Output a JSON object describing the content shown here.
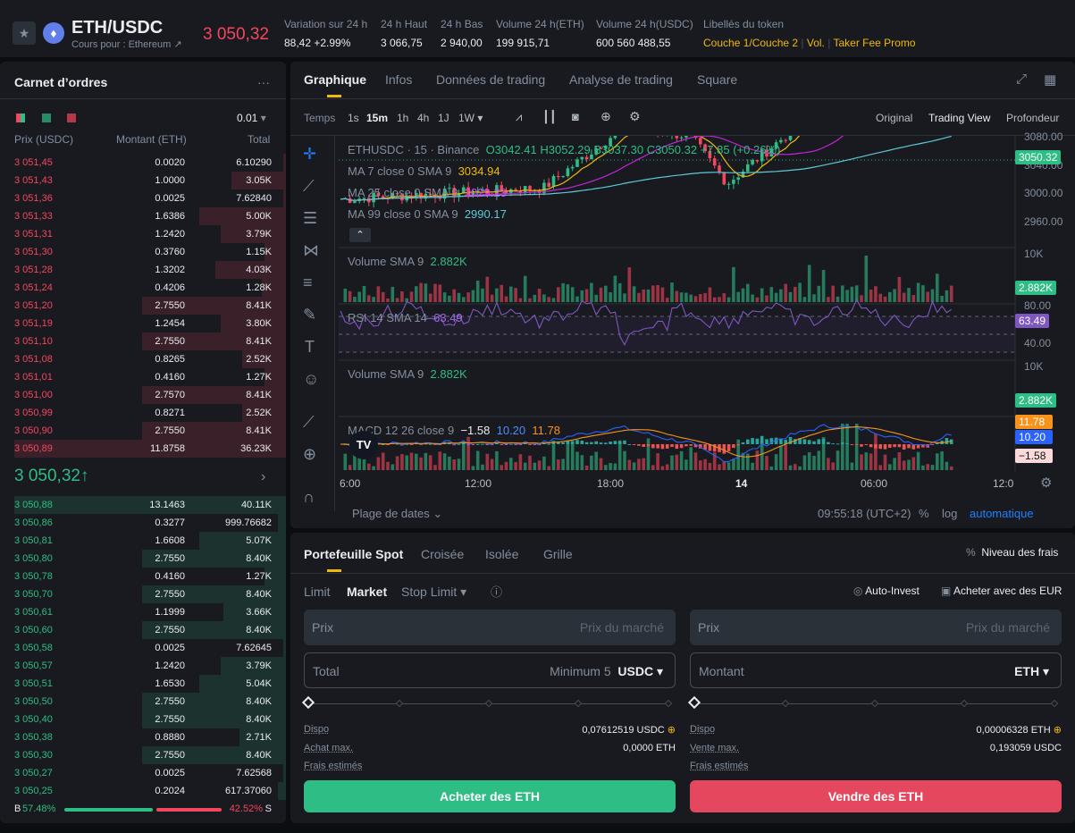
{
  "header": {
    "pair": "ETH/USDC",
    "subtitle": "Cours pour : Ethereum ↗",
    "price": "3 050,32",
    "stats": [
      {
        "label": "Variation sur 24 h",
        "value": "88,42 +2.99%"
      },
      {
        "label": "24 h Haut",
        "value": "3 066,75"
      },
      {
        "label": "24 h Bas",
        "value": "2 940,00"
      },
      {
        "label": "Volume 24 h(ETH)",
        "value": "199 915,71"
      },
      {
        "label": "Volume 24 h(USDC)",
        "value": "600 560 488,55"
      }
    ],
    "token_tags_label": "Libellés du token",
    "token_tags": [
      "Couche 1/Couche 2",
      "Vol.",
      "Taker Fee Promo"
    ]
  },
  "orderbook": {
    "title": "Carnet d’ordres",
    "more": "···",
    "precision": "0.01",
    "col_price": "Prix (USDC)",
    "col_amount": "Montant (ETH)",
    "col_total": "Total",
    "asks": [
      {
        "p": "3 051,45",
        "a": "0.0020",
        "t": "6.10290",
        "d": 0.01
      },
      {
        "p": "3 051,43",
        "a": "1.0000",
        "t": "3.05K",
        "d": 0.2
      },
      {
        "p": "3 051,36",
        "a": "0.0025",
        "t": "7.62840",
        "d": 0.01
      },
      {
        "p": "3 051,33",
        "a": "1.6386",
        "t": "5.00K",
        "d": 0.32
      },
      {
        "p": "3 051,31",
        "a": "1.2420",
        "t": "3.79K",
        "d": 0.24
      },
      {
        "p": "3 051,30",
        "a": "0.3760",
        "t": "1.15K",
        "d": 0.08
      },
      {
        "p": "3 051,28",
        "a": "1.3202",
        "t": "4.03K",
        "d": 0.26
      },
      {
        "p": "3 051,24",
        "a": "0.4206",
        "t": "1.28K",
        "d": 0.09
      },
      {
        "p": "3 051,20",
        "a": "2.7550",
        "t": "8.41K",
        "d": 0.53
      },
      {
        "p": "3 051,19",
        "a": "1.2454",
        "t": "3.80K",
        "d": 0.24
      },
      {
        "p": "3 051,10",
        "a": "2.7550",
        "t": "8.41K",
        "d": 0.53
      },
      {
        "p": "3 051,08",
        "a": "0.8265",
        "t": "2.52K",
        "d": 0.16
      },
      {
        "p": "3 051,01",
        "a": "0.4160",
        "t": "1.27K",
        "d": 0.08
      },
      {
        "p": "3 051,00",
        "a": "2.7570",
        "t": "8.41K",
        "d": 0.53
      },
      {
        "p": "3 050,99",
        "a": "0.8271",
        "t": "2.52K",
        "d": 0.16
      },
      {
        "p": "3 050,90",
        "a": "2.7550",
        "t": "8.41K",
        "d": 0.53
      },
      {
        "p": "3 050,89",
        "a": "11.8758",
        "t": "36.23K",
        "d": 1.0
      }
    ],
    "mid_price": "3 050,32",
    "mid_arrow": "↑",
    "mid_more": "›",
    "bids": [
      {
        "p": "3 050,88",
        "a": "13.1463",
        "t": "40.11K",
        "d": 1.0
      },
      {
        "p": "3 050,86",
        "a": "0.3277",
        "t": "999.76682",
        "d": 0.03
      },
      {
        "p": "3 050,81",
        "a": "1.6608",
        "t": "5.07K",
        "d": 0.32
      },
      {
        "p": "3 050,80",
        "a": "2.7550",
        "t": "8.40K",
        "d": 0.53
      },
      {
        "p": "3 050,78",
        "a": "0.4160",
        "t": "1.27K",
        "d": 0.08
      },
      {
        "p": "3 050,70",
        "a": "2.7550",
        "t": "8.40K",
        "d": 0.53
      },
      {
        "p": "3 050,61",
        "a": "1.1999",
        "t": "3.66K",
        "d": 0.23
      },
      {
        "p": "3 050,60",
        "a": "2.7550",
        "t": "8.40K",
        "d": 0.53
      },
      {
        "p": "3 050,58",
        "a": "0.0025",
        "t": "7.62645",
        "d": 0.01
      },
      {
        "p": "3 050,57",
        "a": "1.2420",
        "t": "3.79K",
        "d": 0.24
      },
      {
        "p": "3 050,51",
        "a": "1.6530",
        "t": "5.04K",
        "d": 0.32
      },
      {
        "p": "3 050,50",
        "a": "2.7550",
        "t": "8.40K",
        "d": 0.53
      },
      {
        "p": "3 050,40",
        "a": "2.7550",
        "t": "8.40K",
        "d": 0.53
      },
      {
        "p": "3 050,38",
        "a": "0.8880",
        "t": "2.71K",
        "d": 0.17
      },
      {
        "p": "3 050,30",
        "a": "2.7550",
        "t": "8.40K",
        "d": 0.53
      },
      {
        "p": "3 050,27",
        "a": "0.0025",
        "t": "7.62568",
        "d": 0.01
      },
      {
        "p": "3 050,25",
        "a": "0.2024",
        "t": "617.37060",
        "d": 0.03
      }
    ],
    "ratio": {
      "b_label": "B",
      "b_pct": "57.48%",
      "s_label": "S",
      "s_pct": "42.52%",
      "buy_share": 0.5748
    }
  },
  "chart": {
    "tabs": [
      "Graphique",
      "Infos",
      "Données de trading",
      "Analyse de trading",
      "Square"
    ],
    "intervals": [
      "Temps",
      "1s",
      "15m",
      "1h",
      "4h",
      "1J",
      "1W ▾"
    ],
    "views": [
      "Original",
      "Trading View",
      "Profondeur"
    ],
    "legend": {
      "symbol": "ETHUSDC · 15 · Binance",
      "o": "O3042.41",
      "h": "H3052.29",
      "l": "B3037.30",
      "c": "C3050.32",
      "chg": "+7.85 (+0.26%)"
    },
    "ma7": {
      "label": "MA 7 close 0 SMA 9",
      "value": "3034.94"
    },
    "ma25": {
      "label": "MA 25 close 0 SMA 9",
      "value": "3029.23"
    },
    "ma99": {
      "label": "MA 99 close 0 SMA 9",
      "value": "2990.17"
    },
    "price_axis": [
      "3080.00",
      "3040.00",
      "3000.00",
      "2960.00"
    ],
    "price_tag": "3050.32",
    "vol1": {
      "label": "Volume SMA 9",
      "value": "2.882K",
      "axis": "10K",
      "tag": "2.882K"
    },
    "rsi": {
      "label": "RSI 14 SMA 14",
      "value": "63.49",
      "axis_top": "80.00",
      "axis_bot": "40.00",
      "tag": "63.49"
    },
    "vol2": {
      "label": "Volume SMA 9",
      "value": "2.882K",
      "axis": "10K",
      "tag": "2.882K"
    },
    "macd": {
      "label": "MACD 12 26 close 9",
      "v1": "−1.58",
      "v2": "10.20",
      "v3": "11.78",
      "tag1": "11.78",
      "tag2": "10.20",
      "tag3": "−1.58"
    },
    "time_axis": [
      "6:00",
      "12:00",
      "18:00",
      "14",
      "06:00",
      "12:0"
    ],
    "date_range": "Plage de dates ⌄",
    "clock": "09:55:18 (UTC+2)",
    "pct": "%",
    "log": "log",
    "auto": "automatique",
    "colors": {
      "up": "#2ebd85",
      "down": "#f6465d",
      "ma7": "#f0b90b",
      "ma25": "#c026d3",
      "ma99": "#5ec8d6",
      "rsi": "#7e57c2"
    }
  },
  "trade": {
    "tabs": [
      "Portefeuille Spot",
      "Croisée",
      "Isolée",
      "Grille"
    ],
    "fee_level": "Niveau des frais",
    "order_types": [
      "Limit",
      "Market",
      "Stop Limit ▾"
    ],
    "auto_invest": "Auto-Invest",
    "buy_eur": "Acheter avec des EUR",
    "buy": {
      "price_label": "Prix",
      "price_placeholder": "Prix du marché",
      "total_label": "Total",
      "total_min": "Minimum 5",
      "total_cur": "USDC ▾",
      "dispo_label": "Dispo",
      "dispo_val": "0,07612519 USDC",
      "max_label": "Achat max.",
      "max_val": "0,0000 ETH",
      "fees_label": "Frais estimés",
      "button": "Acheter des ETH"
    },
    "sell": {
      "price_label": "Prix",
      "price_placeholder": "Prix du marché",
      "amount_label": "Montant",
      "amount_cur": "ETH ▾",
      "dispo_label": "Dispo",
      "dispo_val": "0,00006328 ETH",
      "max_label": "Vente max.",
      "max_val": "0,193059 USDC",
      "fees_label": "Frais estimés",
      "button": "Vendre des ETH"
    }
  }
}
